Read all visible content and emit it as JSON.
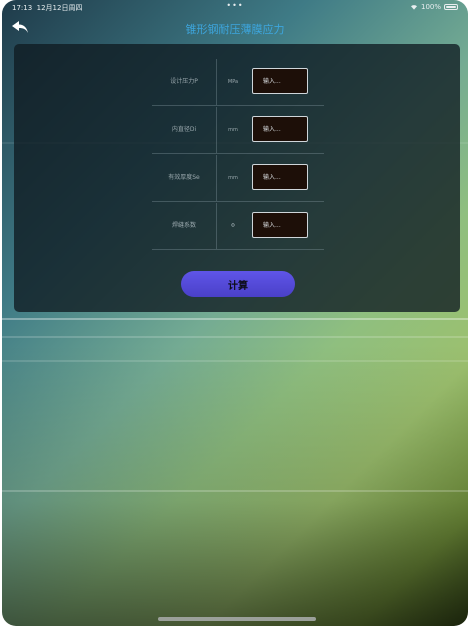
{
  "status_bar": {
    "time": "17:13",
    "date": "12月12日周四",
    "dots": "•••",
    "battery": "100%"
  },
  "nav": {
    "title": "锥形钢耐压薄膜应力"
  },
  "form": {
    "rows": [
      {
        "label": "设计压力P",
        "unit": "MPa",
        "placeholder": "输入..."
      },
      {
        "label": "内直径Di",
        "unit": "mm",
        "placeholder": "输入..."
      },
      {
        "label": "有效厚度Se",
        "unit": "mm",
        "placeholder": "输入..."
      },
      {
        "label": "焊缝系数",
        "unit": "Φ",
        "placeholder": "输入..."
      }
    ],
    "calculate_label": "计算"
  },
  "colors": {
    "title": "#3da6de",
    "button": "#5448d8",
    "panel": "#0f1b21",
    "input_bg": "#1d0f08"
  }
}
